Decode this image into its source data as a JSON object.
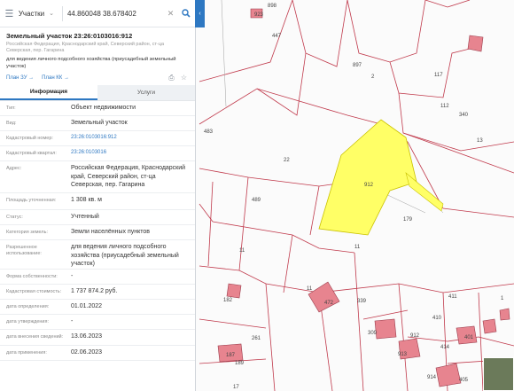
{
  "search": {
    "type_label": "Участки",
    "value": "44.860048 38.678402"
  },
  "panel": {
    "title": "Земельный участок 23:26:0103016:912",
    "address_small": "Российская Федерация, Краснодарский край, Северский район, ст-ца Северская, пер. Гагарина",
    "purpose": "для ведения личного подсобного хозяйства (приусадебный земельный участок)",
    "link_zu": "План ЗУ →",
    "link_kk": "План КК →",
    "tab_info": "Информация",
    "tab_services": "Услуги",
    "rows": [
      {
        "key": "Тип:",
        "value": "Объект недвижимости"
      },
      {
        "key": "Вид:",
        "value": "Земельный участок"
      },
      {
        "key": "Кадастровый номер:",
        "value": "23:26:0103016:912"
      },
      {
        "key": "Кадастровый квартал:",
        "value": "23:26:0103016"
      },
      {
        "key": "Адрес:",
        "value": "Российская Федерация, Краснодарский край, Северский район, ст-ца Северская, пер. Гагарина"
      },
      {
        "key": "Площадь уточненная:",
        "value": "1 308 кв. м"
      },
      {
        "key": "Статус:",
        "value": "Учтенный"
      },
      {
        "key": "Категория земель:",
        "value": "Земли населённых пунктов"
      },
      {
        "key": "Разрешенное использование:",
        "value": "для ведения личного подсобного хозяйства (приусадебный земельный участок)"
      },
      {
        "key": "Форма собственности:",
        "value": "-"
      },
      {
        "key": "Кадастровая стоимость:",
        "value": "1 737 874.2 руб."
      },
      {
        "key": "дата определения:",
        "value": "01.01.2022"
      },
      {
        "key": "дата утверждения:",
        "value": "-"
      },
      {
        "key": "дата внесения сведений:",
        "value": "13.06.2023"
      },
      {
        "key": "дата применения:",
        "value": "02.06.2023"
      }
    ]
  },
  "map": {
    "parcel_labels": [
      "923",
      "898",
      "447",
      "897",
      "2",
      "117",
      "112",
      "340",
      "13",
      "483",
      "22",
      "912",
      "489",
      "179",
      "11",
      "11",
      "182",
      "11",
      "472",
      "339",
      "411",
      "410",
      "261",
      "189",
      "187",
      "309",
      "913",
      "912",
      "914",
      "414",
      "401",
      "17",
      "1",
      "405"
    ]
  },
  "colors": {
    "accent": "#2e78c2",
    "selected_parcel": "#ffff66",
    "building": "#e7848f",
    "boundary": "#c0394b"
  }
}
